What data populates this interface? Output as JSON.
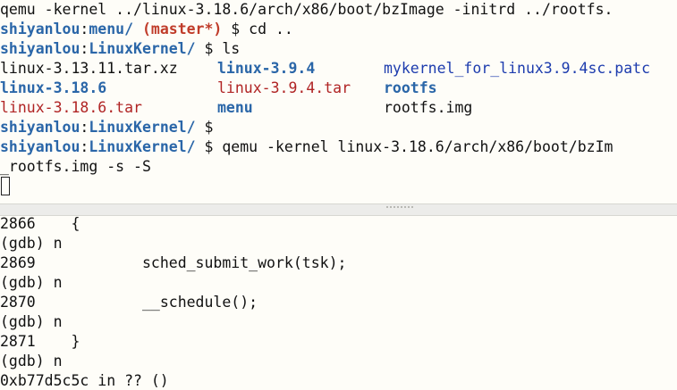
{
  "top_terminal": {
    "line1": "qemu -kernel ../linux-3.18.6/arch/x86/boot/bzImage -initrd ../rootfs.",
    "prompt1": {
      "user": "shiyanlou",
      "sep": ":",
      "path": "menu/",
      "branch": "(master*)",
      "cmd": " $ cd .."
    },
    "prompt2": {
      "user": "shiyanlou",
      "sep": ":",
      "path": "LinuxKernel/",
      "cmd": " $ ls"
    },
    "ls": [
      [
        "linux-3.13.11.tar.xz",
        "linux-3.9.4",
        "mykernel_for_linux3.9.4sc.patc"
      ],
      [
        "linux-3.18.6",
        "linux-3.9.4.tar",
        "rootfs"
      ],
      [
        "linux-3.18.6.tar",
        "menu",
        "rootfs.img"
      ]
    ],
    "prompt3": {
      "user": "shiyanlou",
      "sep": ":",
      "path": "LinuxKernel/",
      "cmd": " $"
    },
    "prompt4": {
      "user": "shiyanlou",
      "sep": ":",
      "path": "LinuxKernel/",
      "cmd": " $ qemu -kernel linux-3.18.6/arch/x86/boot/bzIm"
    },
    "line_cont": "_rootfs.img -s -S"
  },
  "gdb_terminal": {
    "lines": [
      "2866\t{",
      "(gdb) n",
      "2869\t\tsched_submit_work(tsk);",
      "(gdb) n",
      "2870\t\t__schedule();",
      "(gdb) n",
      "2871\t}",
      "(gdb) n",
      "0xb77d5c5c in ?? ()"
    ]
  }
}
